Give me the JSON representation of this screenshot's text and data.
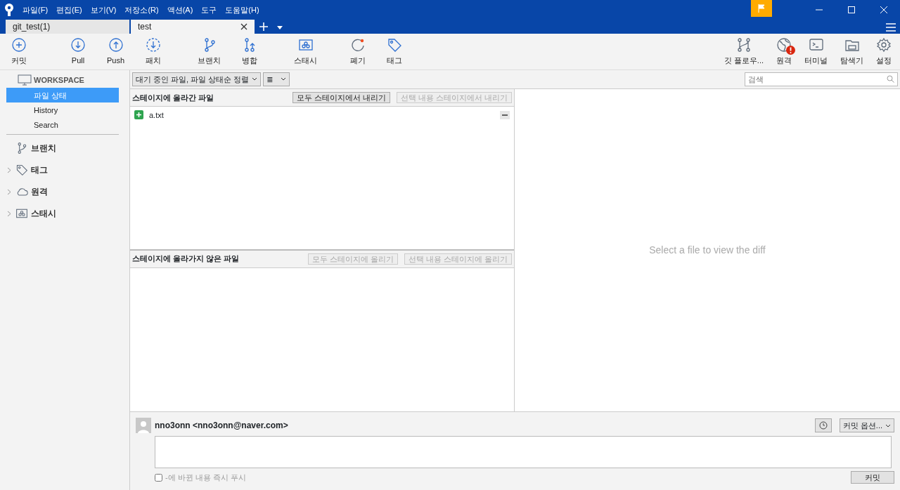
{
  "menu": [
    "파일(F)",
    "편집(E)",
    "보기(V)",
    "저장소(R)",
    "액션(A)",
    "도구",
    "도움말(H)"
  ],
  "tabs": [
    {
      "label": "git_test(1)",
      "selected": false
    },
    {
      "label": "test",
      "selected": true
    }
  ],
  "toolbar_left": [
    {
      "label": "커밋",
      "kind": "commit"
    },
    {
      "label": "Pull",
      "kind": "pull"
    },
    {
      "label": "Push",
      "kind": "push"
    },
    {
      "label": "패치",
      "kind": "fetch"
    },
    {
      "label": "브랜치",
      "kind": "branch"
    },
    {
      "label": "병합",
      "kind": "merge"
    },
    {
      "label": "스태시",
      "kind": "stash"
    },
    {
      "label": "폐기",
      "kind": "discard"
    },
    {
      "label": "태그",
      "kind": "tag"
    }
  ],
  "toolbar_right": [
    {
      "label": "깃 플로우...",
      "kind": "flow",
      "alert": false
    },
    {
      "label": "원격",
      "kind": "globe",
      "alert": true
    },
    {
      "label": "터미널",
      "kind": "terminal",
      "alert": false
    },
    {
      "label": "탐색기",
      "kind": "folder",
      "alert": false
    },
    {
      "label": "설정",
      "kind": "settings",
      "alert": false
    }
  ],
  "sidebar": {
    "workspace": "WORKSPACE",
    "items": [
      {
        "label": "파일 상태",
        "selected": true
      },
      {
        "label": "History",
        "selected": false
      },
      {
        "label": "Search",
        "selected": false
      }
    ],
    "sections": [
      {
        "label": "브랜치",
        "kind": "branch",
        "expandable": false
      },
      {
        "label": "태그",
        "kind": "tag",
        "expandable": true
      },
      {
        "label": "원격",
        "kind": "cloud",
        "expandable": true
      },
      {
        "label": "스태시",
        "kind": "stash",
        "expandable": true
      }
    ]
  },
  "filter": {
    "sort": "대기 중인 파일, 파일 상태순 정렬",
    "view": "≣"
  },
  "search": {
    "placeholder": "검색"
  },
  "staged": {
    "title": "스테이지에 올라간 파일",
    "buttons": [
      {
        "label": "모두 스테이지에서 내리기",
        "disabled": false
      },
      {
        "label": "선택 내용 스테이지에서 내리기",
        "disabled": true
      }
    ],
    "files": [
      {
        "name": "a.txt"
      }
    ]
  },
  "unstaged": {
    "title": "스테이지에 올라가지 않은 파일",
    "buttons": [
      {
        "label": "모두 스테이지에 올리기",
        "disabled": true
      },
      {
        "label": "선택 내용 스테이지에 올리기",
        "disabled": true
      }
    ]
  },
  "diff": {
    "message": "Select a file to view the diff"
  },
  "commit": {
    "author": "nno3onn <nno3onn@naver.com>",
    "options": "커밋 옵션...",
    "push_option": {
      "label": "-에 바뀐 내용 즉시 푸시",
      "checked": false
    },
    "button": "커밋"
  }
}
